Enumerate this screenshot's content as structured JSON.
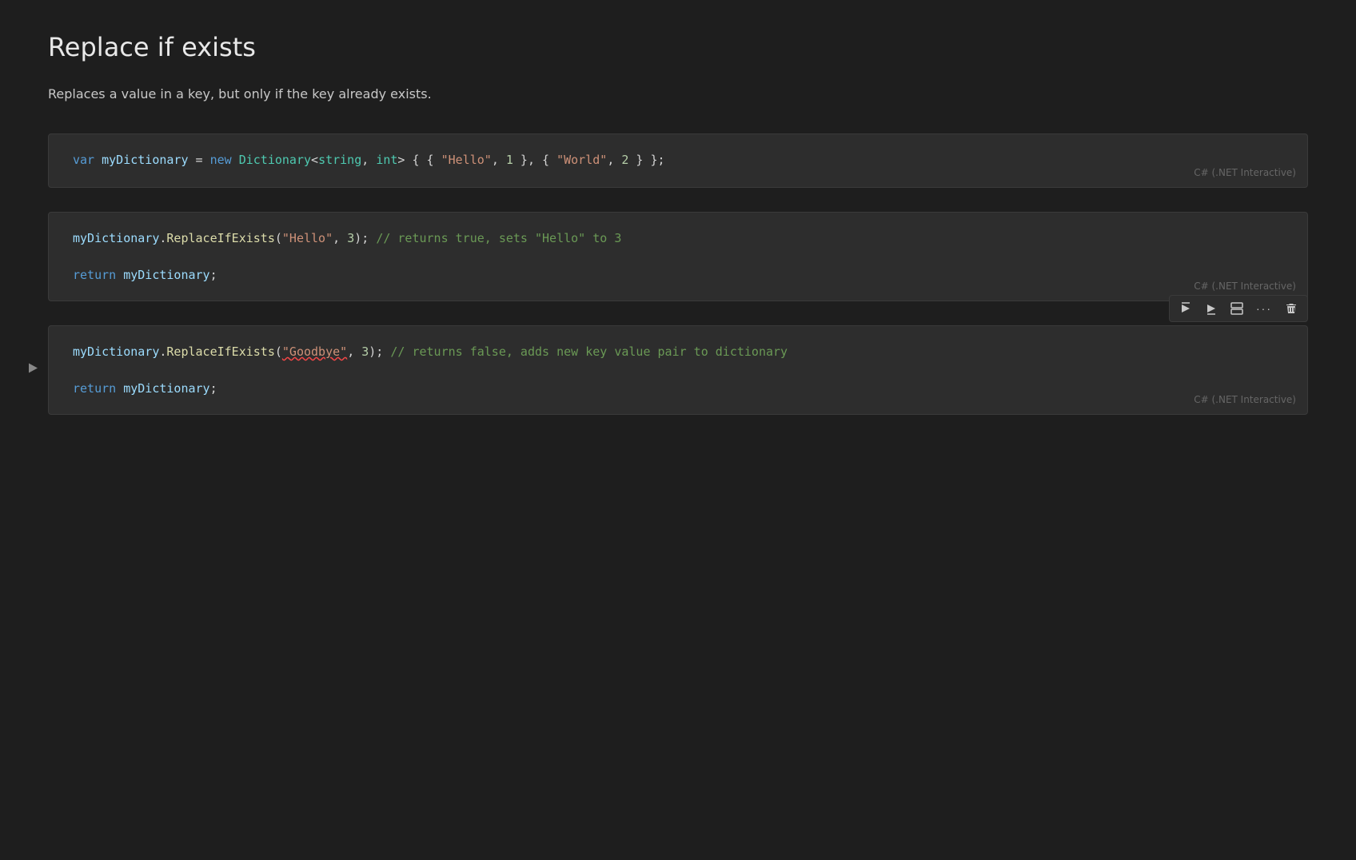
{
  "page": {
    "title": "Replace if exists",
    "description": "Replaces a value in a key, but only if the key already exists."
  },
  "cells": [
    {
      "id": "cell-1",
      "has_run_button": false,
      "label": "C# (.NET Interactive)",
      "has_toolbar": false,
      "code_html": "cell1"
    },
    {
      "id": "cell-2",
      "has_run_button": false,
      "label": "C# (.NET Interactive)",
      "has_toolbar": false,
      "code_html": "cell2"
    },
    {
      "id": "cell-3",
      "has_run_button": true,
      "label": "C# (.NET Interactive)",
      "has_toolbar": true,
      "code_html": "cell3"
    }
  ],
  "toolbar": {
    "buttons": [
      {
        "name": "run-above",
        "icon": "▶↓",
        "label": "Run above"
      },
      {
        "name": "run-below",
        "icon": "▶↑",
        "label": "Run below"
      },
      {
        "name": "split",
        "icon": "⊡",
        "label": "Split cell"
      },
      {
        "name": "more",
        "icon": "···",
        "label": "More"
      },
      {
        "name": "delete",
        "icon": "🗑",
        "label": "Delete"
      }
    ]
  }
}
